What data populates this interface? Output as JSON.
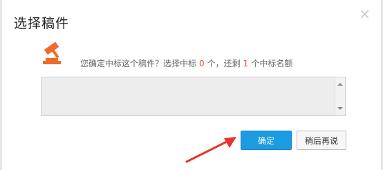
{
  "dialog": {
    "title": "选择稿件",
    "close_symbol": "×"
  },
  "message": {
    "part1": "您确定中标这个稿件？选择中标",
    "selected_count": "0",
    "part2": "个，还剩",
    "remaining_count": "1",
    "part3": "个中标名额"
  },
  "comment": {
    "value": "",
    "placeholder": ""
  },
  "buttons": {
    "confirm": "确定",
    "later": "稍后再说"
  },
  "icons": {
    "gavel": "gavel-icon",
    "close": "close-icon",
    "arrow": "red-arrow-annotation"
  },
  "colors": {
    "accent": "#1b9be0",
    "icon_orange": "#ef6b2a",
    "count_red": "#e04c2f",
    "annotation_red": "#e8332a"
  }
}
